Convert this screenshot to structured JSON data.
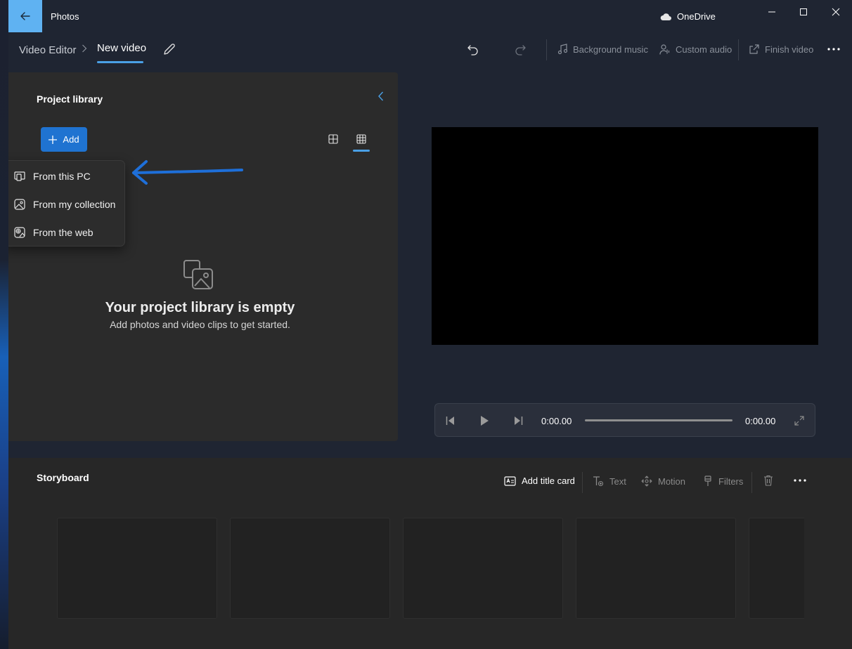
{
  "window": {
    "app_title": "Photos",
    "onedrive_label": "OneDrive"
  },
  "toolbar": {
    "breadcrumb_root": "Video Editor",
    "breadcrumb_current": "New video",
    "background_music_label": "Background music",
    "custom_audio_label": "Custom audio",
    "finish_video_label": "Finish video"
  },
  "library": {
    "title": "Project library",
    "add_label": "Add",
    "empty_title": "Your project library is empty",
    "empty_subtitle": "Add photos and video clips to get started."
  },
  "add_menu": {
    "items": [
      {
        "label": "From this PC",
        "icon": "pc-icon"
      },
      {
        "label": "From my collection",
        "icon": "collection-icon"
      },
      {
        "label": "From the web",
        "icon": "web-image-icon"
      }
    ]
  },
  "player": {
    "current_time": "0:00.00",
    "total_time": "0:00.00",
    "progress": 0
  },
  "storyboard": {
    "title": "Storyboard",
    "add_title_card_label": "Add title card",
    "text_label": "Text",
    "motion_label": "Motion",
    "filters_label": "Filters"
  },
  "colors": {
    "accent": "#1f73d1",
    "back_button": "#5fb2f2",
    "annotation_arrow": "#1e6fd9"
  }
}
